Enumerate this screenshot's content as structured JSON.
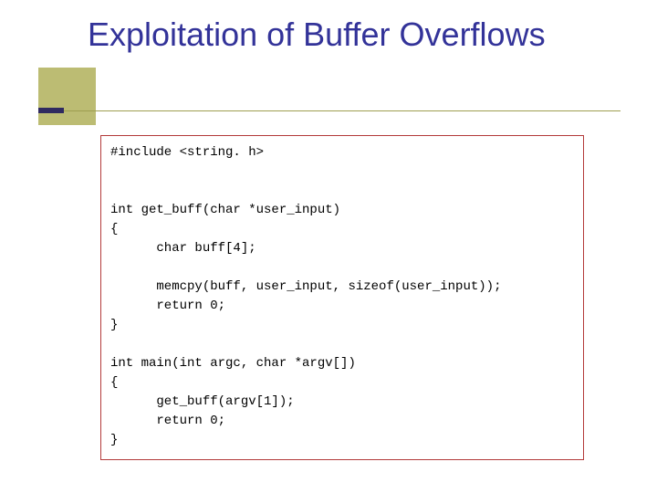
{
  "title": "Exploitation of Buffer\nOverflows",
  "code": "#include <string. h>\n\n\nint get_buff(char *user_input)\n{\n      char buff[4];\n\n      memcpy(buff, user_input, sizeof(user_input));\n      return 0;\n}\n\nint main(int argc, char *argv[])\n{\n      get_buff(argv[1]);\n      return 0;\n}"
}
